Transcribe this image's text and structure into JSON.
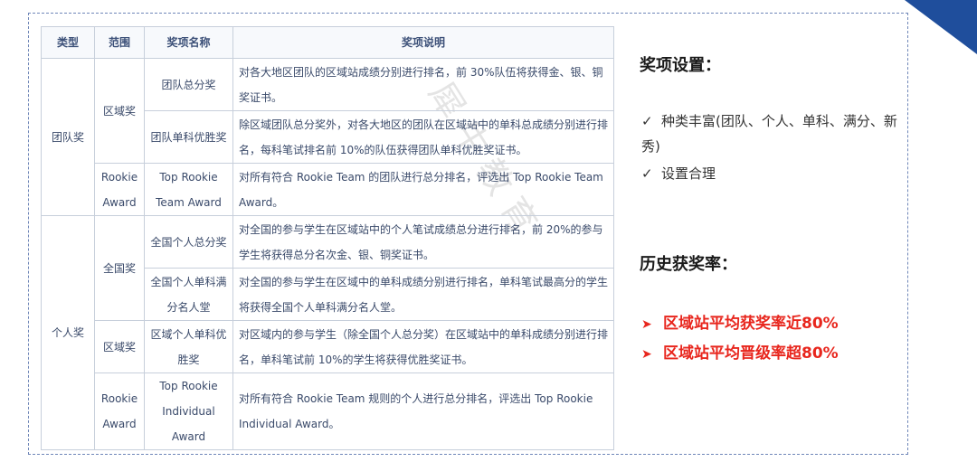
{
  "table": {
    "headers": [
      "类型",
      "范围",
      "奖项名称",
      "奖项说明"
    ],
    "team_type": "团队奖",
    "individual_type": "个人奖",
    "rows": [
      {
        "range": "区域奖",
        "name": "团队总分奖",
        "desc": "对各大地区团队的区域站成绩分别进行排名，前 30%队伍将获得金、银、铜奖证书。"
      },
      {
        "range": "",
        "name": "团队单科优胜奖",
        "desc": "除区域团队总分奖外，对各大地区的团队在区域站中的单科总成绩分别进行排名，每科笔试排名前 10%的队伍获得团队单科优胜奖证书。"
      },
      {
        "range": "Rookie Award",
        "name": "Top Rookie Team Award",
        "desc": "对所有符合 Rookie Team 的团队进行总分排名，评选出 Top Rookie Team Award。"
      },
      {
        "range": "全国奖",
        "name": "全国个人总分奖",
        "desc": "对全国的参与学生在区域站中的个人笔试成绩总分进行排名，前 20%的参与学生将获得总分名次金、银、铜奖证书。"
      },
      {
        "range": "",
        "name": "全国个人单科满分名人堂",
        "desc": "对全国的参与学生在区域中的单科成绩分别进行排名，单科笔试最高分的学生将获得全国个人单科满分名人堂。"
      },
      {
        "range": "区域奖",
        "name": "区域个人单科优胜奖",
        "desc": "对区域内的参与学生（除全国个人总分奖）在区域站中的单科成绩分别进行排名，单科笔试前 10%的学生将获得优胜奖证书。"
      },
      {
        "range": "Rookie Award",
        "name": "Top Rookie Individual Award",
        "desc": "对所有符合 Rookie Team 规则的个人进行总分排名，评选出 Top Rookie Individual Award。"
      }
    ]
  },
  "panel": {
    "setting_title": "奖项设置：",
    "checks": [
      "种类丰富(团队、个人、单科、满分、新秀)",
      "设置合理"
    ],
    "history_title": "历史获奖率：",
    "rates": [
      "区域站平均获奖率近80%",
      "区域站平均晋级率超80%"
    ]
  },
  "icons": {
    "check": "check-icon",
    "arrow": "arrow-icon"
  },
  "colors": {
    "accent_red": "#e8261d",
    "corner_blue": "#1f4e9c"
  }
}
